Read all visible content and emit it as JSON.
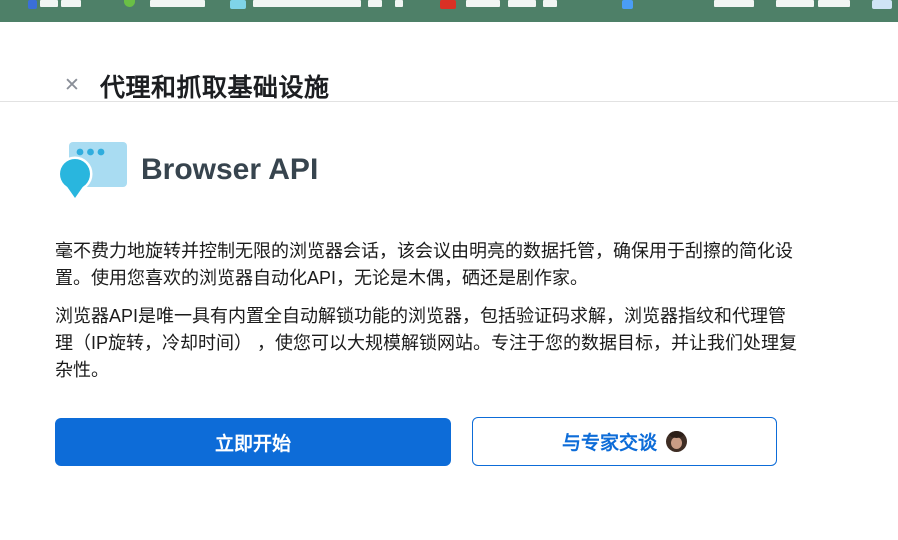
{
  "modal": {
    "close_icon": "✕",
    "title": "代理和抓取基础设施",
    "product": {
      "name": "Browser API",
      "icon": "browser-window-with-location-pin"
    },
    "paragraphs": [
      "毫不费力地旋转并控制无限的浏览器会话，该会议由明亮的数据托管，确保用于刮擦的简化设置。使用您喜欢的浏览器自动化API，无论是木偶，硒还是剧作家。",
      "浏览器API是唯一具有内置全自动解锁功能的浏览器，包括验证码求解，浏览器指纹和代理管理（IP旋转，冷却时间） ，使您可以大规模解锁网站。专注于您的数据目标，并让我们处理复杂性。"
    ],
    "actions": {
      "primary_label": "立即开始",
      "secondary_label": "与专家交谈",
      "secondary_avatar": "expert-avatar-photo"
    }
  },
  "colors": {
    "bookmarks_bar_green": "#4e8068",
    "primary_blue": "#0d6cd8",
    "icon_window_blue": "#a9dcf2",
    "icon_pin_cyan": "#29b6de",
    "heading_dark": "#37444e",
    "body_text": "#1b1b1b",
    "divider": "#e2e2e2"
  }
}
